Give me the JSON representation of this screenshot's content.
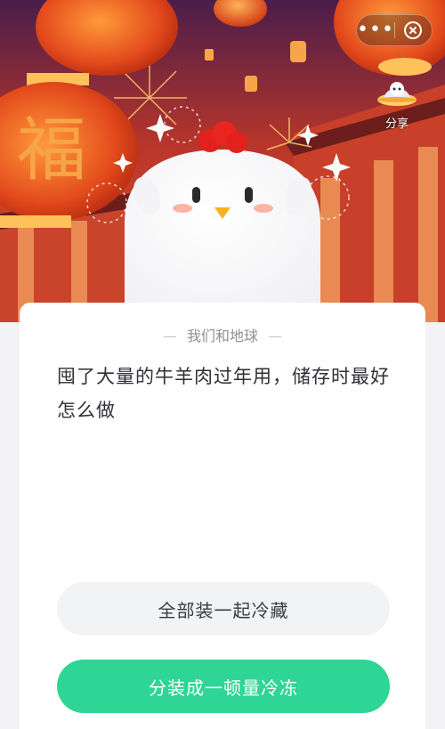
{
  "header": {
    "more_glyph": "•••",
    "share_label": "分享"
  },
  "quiz": {
    "category": "我们和地球",
    "category_dash": "—",
    "question": "囤了大量的牛羊肉过年用，储存时最好怎么做",
    "options": [
      {
        "label": "全部装一起冷藏"
      },
      {
        "label": "分装成一顿量冷冻"
      }
    ]
  },
  "banner": {
    "lantern_char": "福"
  },
  "colors": {
    "accent_green": "#2fd595",
    "option_bg": "#f2f3f5",
    "question_text": "#2f3035",
    "category_text": "#8d8f95"
  },
  "icons": [
    "more-icon",
    "close-icon",
    "share-icon",
    "chick-mascot"
  ]
}
